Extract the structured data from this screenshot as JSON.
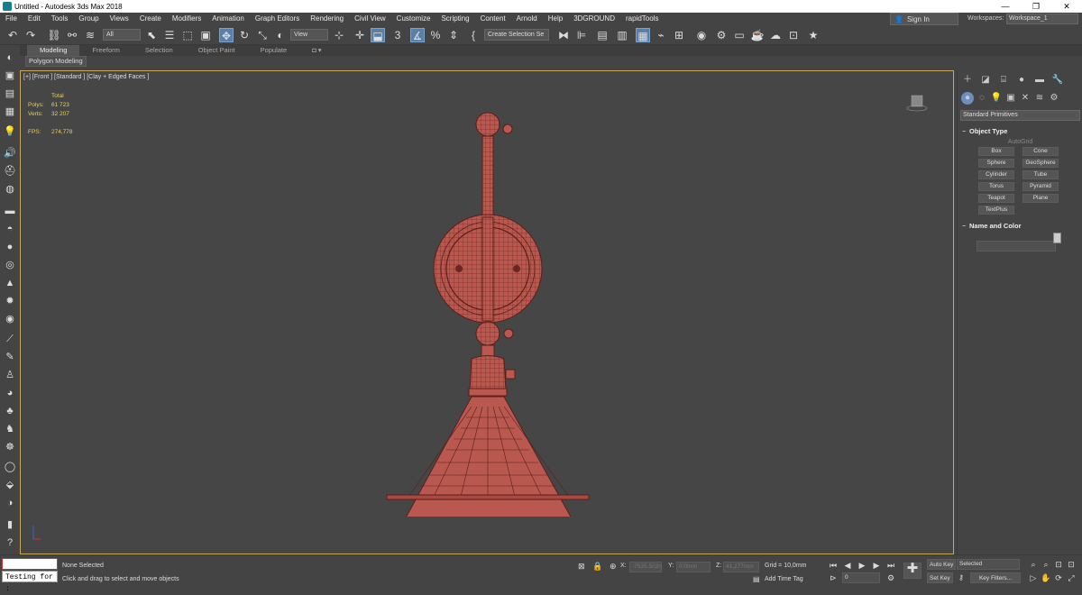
{
  "window": {
    "title": "Untitled - Autodesk 3ds Max 2018",
    "minimize": "—",
    "restore": "❐",
    "close": "✕"
  },
  "menu": [
    "File",
    "Edit",
    "Tools",
    "Group",
    "Views",
    "Create",
    "Modifiers",
    "Animation",
    "Graph Editors",
    "Rendering",
    "Civil View",
    "Customize",
    "Scripting",
    "Content",
    "Arnold",
    "Help",
    "3DGROUND",
    "rapidTools"
  ],
  "account": {
    "signin": "Sign In",
    "workspaces_label": "Workspaces:",
    "workspace": "Workspace_1"
  },
  "toolbar": {
    "filter": "All",
    "ref_coord": "View",
    "snap_value": "3",
    "selection_set": "Create Selection Se"
  },
  "ribbon": {
    "tabs": [
      "Modeling",
      "Freeform",
      "Selection",
      "Object Paint",
      "Populate"
    ],
    "active": "Modeling",
    "sub": "Polygon Modeling"
  },
  "viewport": {
    "label": "[+] [Front ] [Standard ] [Clay + Edged Faces ]",
    "stats": {
      "total": "Total",
      "polys_k": "Polys:",
      "polys_v": "61 723",
      "verts_k": "Verts:",
      "verts_v": "32 207",
      "fps_k": "FPS:",
      "fps_v": "274,778"
    }
  },
  "command_panel": {
    "category": "Standard Primitives",
    "object_type": "Object Type",
    "autogrid": "AutoGrid",
    "buttons": [
      "Box",
      "Cone",
      "Sphere",
      "GeoSphere",
      "Cylinder",
      "Tube",
      "Torus",
      "Pyramid",
      "Teapot",
      "Plane",
      "TextPlus"
    ],
    "name_color": "Name and Color"
  },
  "status": {
    "testing": "Testing for :",
    "selection": "None Selected",
    "prompt": "Click and drag to select and move objects",
    "x_label": "X:",
    "x_val": "-7535,502n",
    "y_label": "Y:",
    "y_val": "0,0mm",
    "z_label": "Z:",
    "z_val": "41,277mm",
    "grid": "Grid = 10,0mm",
    "add_time_tag": "Add Time Tag",
    "frame": "0",
    "auto_key": "Auto Key",
    "set_key": "Set Key",
    "selected": "Selected",
    "key_filters": "Key Filters..."
  },
  "colors": {
    "model": "#b9584f",
    "wire": "#5a1e1a",
    "viewport_border": "#c8a85b",
    "stats": "#e8d24a"
  }
}
